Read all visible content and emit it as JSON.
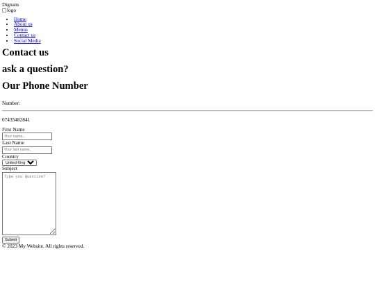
{
  "site": {
    "name": "Dignans",
    "logo_alt": "logo"
  },
  "nav": {
    "items": [
      {
        "label": "Home"
      },
      {
        "label": "About us"
      },
      {
        "label": "Menus"
      },
      {
        "label": "Contact us"
      },
      {
        "label": "Social Media"
      }
    ]
  },
  "headings": {
    "contact": "Contact us",
    "ask": "ask a question?",
    "phone_title": "Our Phone Number"
  },
  "phone": {
    "label": "Number:",
    "value": "07435482841"
  },
  "form": {
    "first_name_label": "First Name",
    "first_name_placeholder": "Your name..",
    "last_name_label": "Last Name",
    "last_name_placeholder": "Your last name..",
    "country_label": "Country",
    "country_selected": "United Kingdom",
    "subject_label": "Subject",
    "subject_placeholder": "Type you Question?",
    "submit_label": "Submit"
  },
  "footer": {
    "text": "© 2023 My Website. All rights reserved."
  }
}
